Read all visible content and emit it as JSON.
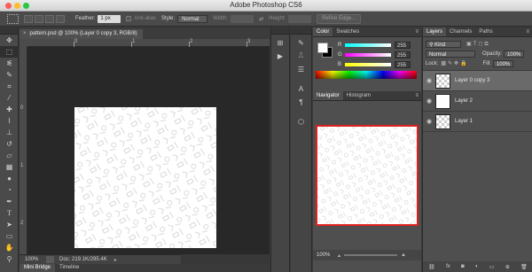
{
  "window": {
    "title": "Adobe Photoshop CS6"
  },
  "options_bar": {
    "feather_label": "Feather:",
    "feather_value": "1 px",
    "anti_alias_label": "Anti-alias",
    "style_label": "Style:",
    "style_value": "Normal",
    "width_label": "Width:",
    "height_label": "Height:",
    "refine_edge_label": "Refine Edge..."
  },
  "tools": [
    "move-icon",
    "marquee-icon",
    "lasso-icon",
    "quick-select-icon",
    "crop-icon",
    "eyedropper-icon",
    "healing-icon",
    "brush-icon",
    "clone-stamp-icon",
    "history-brush-icon",
    "eraser-icon",
    "gradient-icon",
    "blur-icon",
    "dodge-icon",
    "pen-icon",
    "type-icon"
  ],
  "document": {
    "tab_label": "pattern.psd @ 100% (Layer 0 copy 3, RGB/8)",
    "close_glyph": "×",
    "ruler_h_labels": [
      "0",
      "1",
      "2",
      "3"
    ],
    "ruler_v_labels": [
      "0",
      "1",
      "2"
    ],
    "zoom": "100%",
    "doc_info": "Doc: 219.1K/295.4K"
  },
  "bottom_tabs": [
    "Mini Bridge",
    "Timeline"
  ],
  "color_panel": {
    "tabs": [
      "Color",
      "Swatches"
    ],
    "r_label": "R",
    "r_value": "255",
    "g_label": "G",
    "g_value": "255",
    "b_label": "B",
    "b_value": "255"
  },
  "navigator_panel": {
    "tabs": [
      "Navigator",
      "Histogram"
    ],
    "zoom": "100%"
  },
  "layers_panel": {
    "tabs": [
      "Layers",
      "Channels",
      "Paths"
    ],
    "kind_label": "Kind",
    "blend_mode": "Normal",
    "opacity_label": "Opacity:",
    "opacity_value": "100%",
    "lock_label": "Lock:",
    "fill_label": "Fill:",
    "fill_value": "100%",
    "layers": [
      {
        "name": "Layer 0 copy 3",
        "selected": true
      },
      {
        "name": "Layer 2",
        "selected": false
      },
      {
        "name": "Layer 1",
        "selected": false
      }
    ],
    "footer_labels": [
      "fx"
    ]
  },
  "colors": {
    "navigator_frame": "#e02020",
    "canvas_bg": "#282828",
    "panel_bg": "#4f4f4f"
  }
}
